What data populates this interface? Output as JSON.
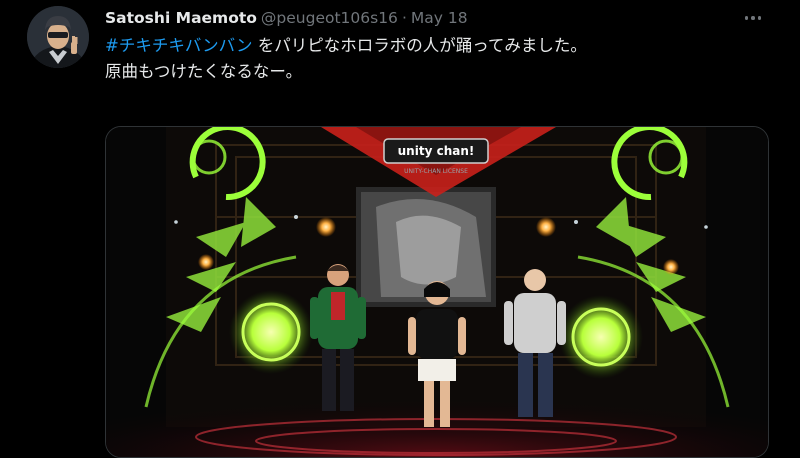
{
  "tweet": {
    "author": {
      "display_name": "Satoshi Maemoto",
      "handle": "@peugeot106s16",
      "separator": "·",
      "date": "May 18"
    },
    "text": {
      "hashtag": "#チキチキバンバン",
      "line1_rest": " をパリピなホロラボの人が踊ってみました。",
      "line2": "原曲もつけたくなるなー。"
    },
    "media": {
      "stage_sign_text": "unity chan!",
      "stage_sign_sub": "UNITY-CHAN LICENSE"
    },
    "more_icon": "more-horizontal-icon"
  },
  "colors": {
    "background": "#000000",
    "text_primary": "#e7e9ea",
    "text_secondary": "#71767b",
    "link": "#1d9bf0",
    "border": "#2f3336",
    "stage_green": "#9cff3a",
    "stage_red": "#e8261f"
  }
}
